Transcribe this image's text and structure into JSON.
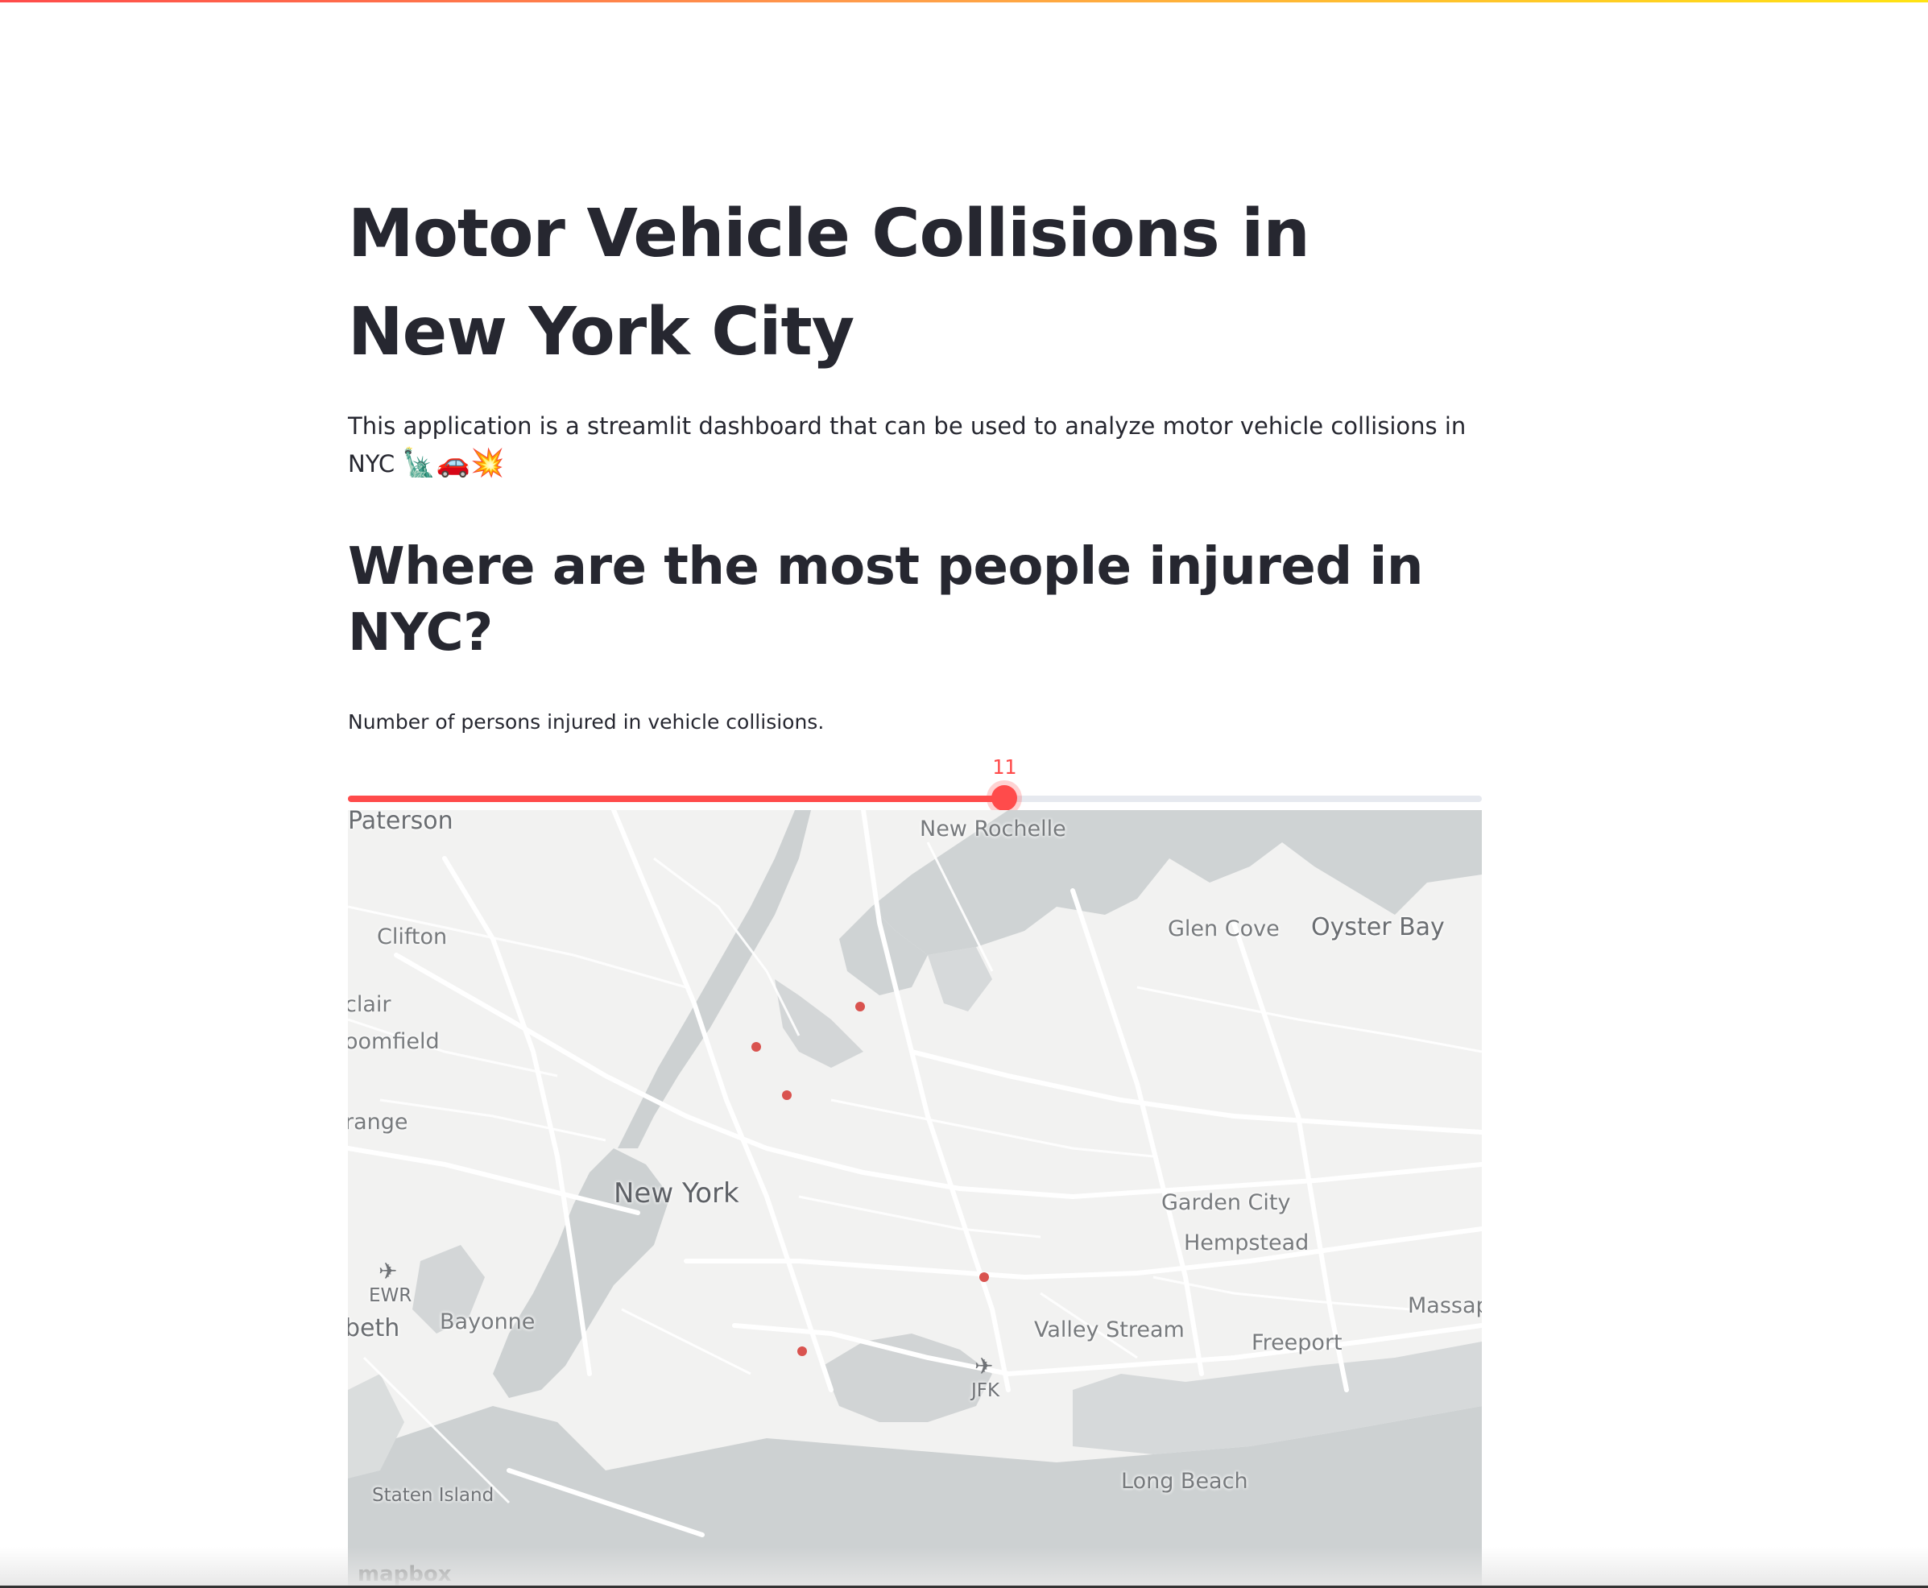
{
  "title": "Motor Vehicle Collisions in New York City",
  "description": "This application is a streamlit dashboard that can be used to analyze motor vehicle collisions in NYC",
  "description_emojis": "🗽🚗💥",
  "subheader": "Where are the most people injured in NYC?",
  "slider": {
    "label": "Number of persons injured in vehicle collisions.",
    "value": "11",
    "min": "0",
    "max": "19",
    "value_fraction": 0.579,
    "color": "#ff4b4b"
  },
  "map": {
    "point_color": "#d9534f",
    "labels": {
      "paterson": "Paterson",
      "new_rochelle": "New Rochelle",
      "clifton": "Clifton",
      "glen_cove": "Glen Cove",
      "oyster_bay": "Oyster Bay",
      "montclair": "clair",
      "bloomfield": "oomfield",
      "orange": "range",
      "new_york": "New York",
      "garden_city": "Garden City",
      "hempstead": "Hempstead",
      "ewr": "EWR",
      "elizabeth": "beth",
      "bayonne": "Bayonne",
      "massapequa": "Massap",
      "valley_stream": "Valley Stream",
      "freeport": "Freeport",
      "jfk": "JFK",
      "staten_island": "Staten Island",
      "long_beach": "Long Beach"
    },
    "attribution": "mapbox"
  }
}
